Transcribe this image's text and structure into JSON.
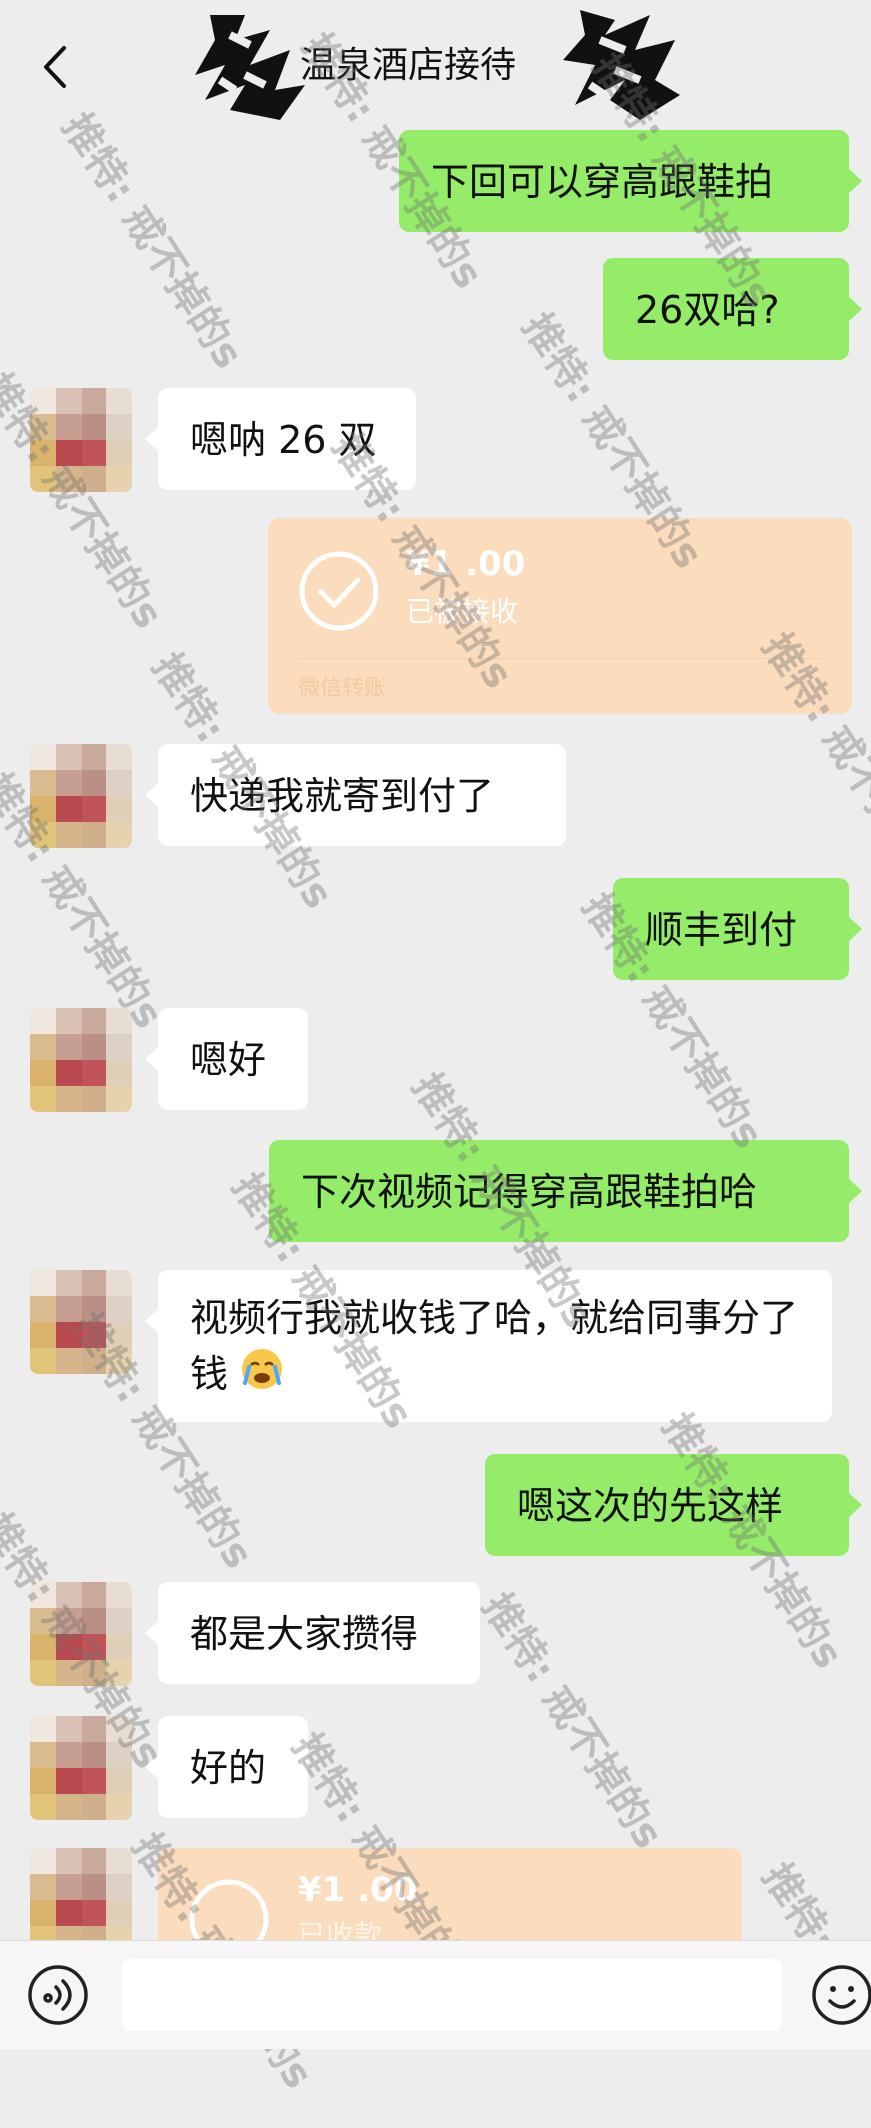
{
  "header": {
    "title": "温泉酒店接待"
  },
  "messages": {
    "m1": {
      "text": "下回可以穿高跟鞋拍"
    },
    "m2": {
      "text": "26双哈?"
    },
    "m3": {
      "text": "嗯呐 26 双"
    },
    "m5": {
      "text": "快递我就寄到付了"
    },
    "m6": {
      "text": "顺丰到付"
    },
    "m7": {
      "text": "嗯好"
    },
    "m8": {
      "text": "下次视频记得穿高跟鞋拍哈"
    },
    "m9": {
      "text": "视频行我就收钱了哈，就给同事分了钱"
    },
    "m10": {
      "text": "嗯这次的先这样"
    },
    "m11": {
      "text": "都是大家攒得"
    },
    "m12": {
      "text": "好的"
    }
  },
  "transfers": {
    "t1": {
      "amount": "¥1 .00",
      "status": "已被接收",
      "label": "微信转账"
    },
    "t2": {
      "amount": "¥1 .00",
      "status": "已收款"
    }
  },
  "watermark": {
    "text": "推特: 戒不掉的s"
  },
  "icons": {
    "back": "chevron-left-icon",
    "voice": "voice-icon",
    "emoji": "emoji-icon",
    "check": "check-circle-icon",
    "cry": "crying-face-icon"
  },
  "colors": {
    "outgoing": "#95ec69",
    "incoming": "#ffffff",
    "transfer": "#fbdcbd",
    "background": "#ededed"
  }
}
